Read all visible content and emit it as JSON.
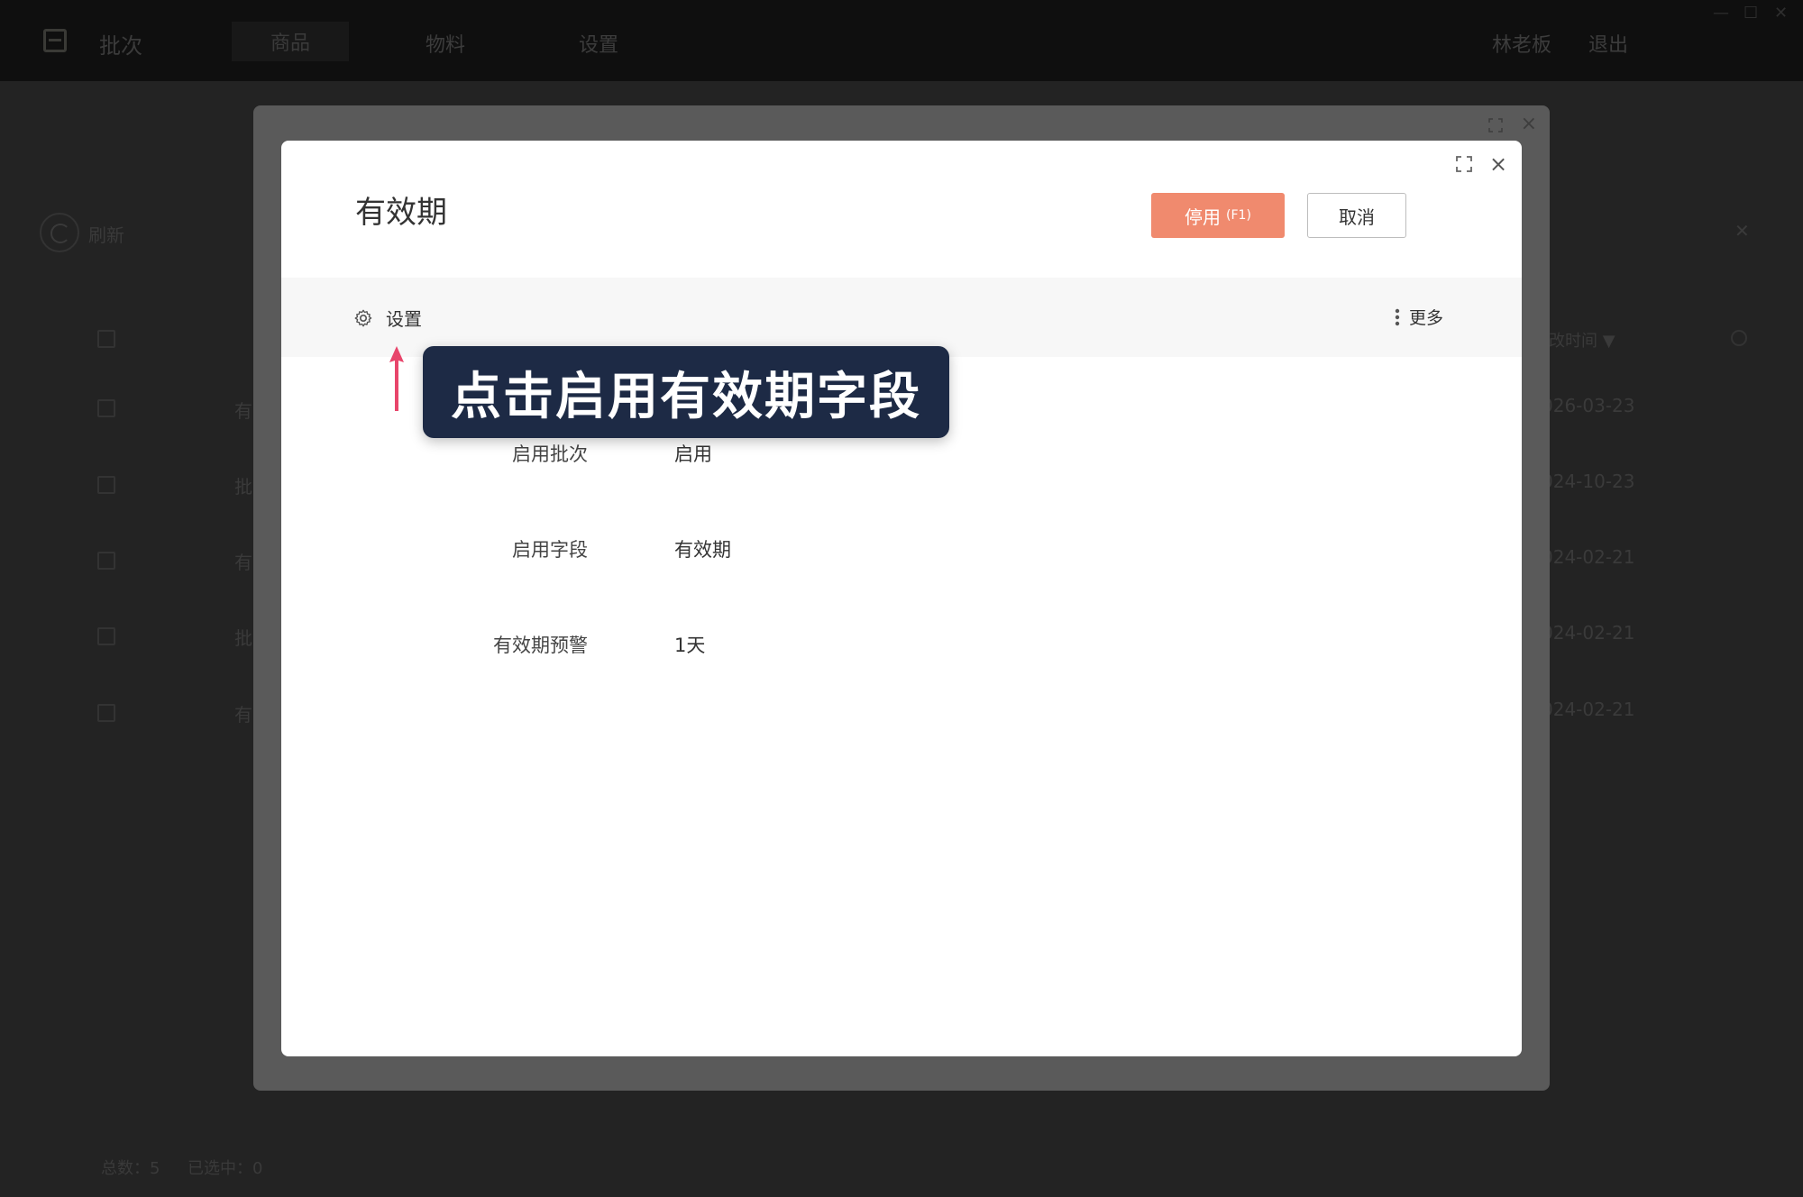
{
  "app": {
    "title": "批次",
    "tabs": [
      "商品",
      "物料",
      "设置"
    ],
    "user": "林老板",
    "logout": "退出",
    "window_controls": [
      "—",
      "☐",
      "✕"
    ]
  },
  "background": {
    "refresh_label": "刷新",
    "column_header": "改时间 ▼",
    "row_fragments": [
      "有",
      "批",
      "有",
      "批",
      "有"
    ],
    "row_dates": [
      "026-03-23",
      "024-10-23",
      "024-02-21",
      "024-02-21",
      "024-02-21"
    ],
    "footer_total": "总数：5",
    "footer_selected": "已选中：0"
  },
  "dialog": {
    "title": "有效期",
    "disable_label": "停用",
    "disable_hotkey": "(F1)",
    "cancel_label": "取消",
    "toolbar": {
      "settings_label": "设置",
      "more_label": "更多"
    },
    "fields": [
      {
        "label": "启用批次",
        "value": "启用"
      },
      {
        "label": "启用字段",
        "value": "有效期"
      },
      {
        "label": "有效期预警",
        "value": "1天"
      }
    ]
  },
  "tooltip": {
    "text": "点击启用有效期字段"
  },
  "colors": {
    "primary_button": "#f08a6e",
    "tooltip_bg": "#1d2a45",
    "arrow": "#e8456b"
  },
  "icons": [
    "gear-icon",
    "more-dots-icon",
    "expand-icon",
    "close-icon",
    "arrow-up-icon",
    "refresh-icon"
  ]
}
